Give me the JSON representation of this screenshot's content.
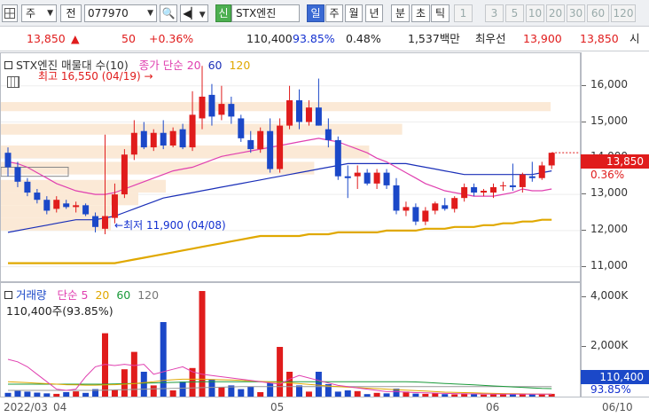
{
  "toolbar": {
    "market_type": "주",
    "tab_jeon": "전",
    "code": "077970",
    "badge_shin": "신",
    "stock_name": "STX엔진",
    "periods": [
      "일",
      "주",
      "월",
      "년"
    ],
    "intraday": [
      "분",
      "초",
      "틱"
    ],
    "intervals": [
      "1",
      "3",
      "5",
      "10",
      "20",
      "30",
      "60",
      "120"
    ],
    "selected_period": "일"
  },
  "quote": {
    "price": "13,850",
    "change": "50",
    "change_pct": "+0.36%",
    "volume": "110,400",
    "vol_ratio": "93.85%",
    "turnover_rate": "0.48%",
    "amount": "1,537백만",
    "best_label": "최우선",
    "ask": "13,900",
    "bid": "13,850",
    "trailing": "시"
  },
  "price_pane": {
    "title": "STX엔진 매물대 수(10)",
    "ma_label": "종가 단순",
    "ma_periods": [
      "20",
      "60",
      "120"
    ],
    "high_note": "최고 16,550 (04/19)",
    "low_note": "최저 11,900 (04/08)",
    "y_ticks": [
      "16,000",
      "15,000",
      "14,000",
      "13,000",
      "12,000",
      "11,000"
    ],
    "current_price": "13,850",
    "current_pct": "0.36%"
  },
  "volume_pane": {
    "title": "거래량",
    "ma_label": "단순",
    "ma_periods": [
      "5",
      "20",
      "60",
      "120"
    ],
    "info": "110,400주(93.85%)",
    "y_ticks": [
      "4,000K",
      "2,000K"
    ],
    "current_volume": "110,400",
    "current_pct": "93.85%"
  },
  "xaxis": {
    "labels": [
      "2022/03",
      "04",
      "05",
      "06",
      "06/10"
    ]
  },
  "colors": {
    "up": "#e01c1c",
    "down": "#1b48c8",
    "ma20": "#e040b0",
    "ma60": "#1a2fb8",
    "ma120": "#e0a800",
    "volume_ma60": "#1a9a3a"
  },
  "chart_data": {
    "type": "candlestick",
    "ylim": [
      10600,
      16900
    ],
    "candles": [
      {
        "o": 14150,
        "h": 14300,
        "l": 13500,
        "c": 13750
      },
      {
        "o": 13750,
        "h": 13900,
        "l": 13200,
        "c": 13350
      },
      {
        "o": 13350,
        "h": 13450,
        "l": 12950,
        "c": 13050
      },
      {
        "o": 13050,
        "h": 13150,
        "l": 12750,
        "c": 12850
      },
      {
        "o": 12850,
        "h": 12950,
        "l": 12450,
        "c": 12550
      },
      {
        "o": 12600,
        "h": 12950,
        "l": 12500,
        "c": 12850
      },
      {
        "o": 12750,
        "h": 12850,
        "l": 12600,
        "c": 12650
      },
      {
        "o": 12650,
        "h": 12800,
        "l": 12500,
        "c": 12700
      },
      {
        "o": 12700,
        "h": 12750,
        "l": 12400,
        "c": 12450
      },
      {
        "o": 12400,
        "h": 12500,
        "l": 11950,
        "c": 12100
      },
      {
        "o": 12050,
        "h": 14650,
        "l": 11900,
        "c": 12400
      },
      {
        "o": 12350,
        "h": 13300,
        "l": 12200,
        "c": 13000
      },
      {
        "o": 13000,
        "h": 14250,
        "l": 12900,
        "c": 14100
      },
      {
        "o": 14100,
        "h": 15050,
        "l": 13950,
        "c": 14700
      },
      {
        "o": 14750,
        "h": 15000,
        "l": 14250,
        "c": 14300
      },
      {
        "o": 14300,
        "h": 14800,
        "l": 14200,
        "c": 14700
      },
      {
        "o": 14700,
        "h": 15050,
        "l": 14250,
        "c": 14350
      },
      {
        "o": 14350,
        "h": 14850,
        "l": 14300,
        "c": 14750
      },
      {
        "o": 14800,
        "h": 14950,
        "l": 14250,
        "c": 14300
      },
      {
        "o": 14300,
        "h": 15850,
        "l": 14200,
        "c": 15200
      },
      {
        "o": 15100,
        "h": 16550,
        "l": 14800,
        "c": 15700
      },
      {
        "o": 15750,
        "h": 16050,
        "l": 14900,
        "c": 15150
      },
      {
        "o": 15200,
        "h": 16000,
        "l": 15050,
        "c": 15500
      },
      {
        "o": 15500,
        "h": 15700,
        "l": 14950,
        "c": 15150
      },
      {
        "o": 15100,
        "h": 15200,
        "l": 14450,
        "c": 14550
      },
      {
        "o": 14500,
        "h": 14750,
        "l": 14150,
        "c": 14250
      },
      {
        "o": 14250,
        "h": 14850,
        "l": 14150,
        "c": 14750
      },
      {
        "o": 14750,
        "h": 15100,
        "l": 13600,
        "c": 13700
      },
      {
        "o": 13700,
        "h": 15100,
        "l": 13600,
        "c": 14900
      },
      {
        "o": 14900,
        "h": 16000,
        "l": 14800,
        "c": 15600
      },
      {
        "o": 15600,
        "h": 15900,
        "l": 14800,
        "c": 15000
      },
      {
        "o": 15000,
        "h": 15600,
        "l": 14900,
        "c": 15400
      },
      {
        "o": 15400,
        "h": 16200,
        "l": 14900,
        "c": 14900
      },
      {
        "o": 14800,
        "h": 15100,
        "l": 14300,
        "c": 14500
      },
      {
        "o": 14500,
        "h": 14600,
        "l": 13400,
        "c": 13500
      },
      {
        "o": 13500,
        "h": 13800,
        "l": 12900,
        "c": 13450
      },
      {
        "o": 13500,
        "h": 13800,
        "l": 13150,
        "c": 13600
      },
      {
        "o": 13600,
        "h": 13700,
        "l": 13250,
        "c": 13300
      },
      {
        "o": 13300,
        "h": 13700,
        "l": 13150,
        "c": 13600
      },
      {
        "o": 13600,
        "h": 13700,
        "l": 13150,
        "c": 13250
      },
      {
        "o": 13250,
        "h": 13450,
        "l": 12450,
        "c": 12550
      },
      {
        "o": 12550,
        "h": 12800,
        "l": 12400,
        "c": 12650
      },
      {
        "o": 12650,
        "h": 12750,
        "l": 12150,
        "c": 12250
      },
      {
        "o": 12250,
        "h": 12650,
        "l": 12150,
        "c": 12550
      },
      {
        "o": 12550,
        "h": 12800,
        "l": 12450,
        "c": 12750
      },
      {
        "o": 12700,
        "h": 12900,
        "l": 12550,
        "c": 12600
      },
      {
        "o": 12600,
        "h": 12950,
        "l": 12500,
        "c": 12900
      },
      {
        "o": 12900,
        "h": 13300,
        "l": 12800,
        "c": 13200
      },
      {
        "o": 13200,
        "h": 13300,
        "l": 12950,
        "c": 13050
      },
      {
        "o": 13050,
        "h": 13150,
        "l": 12950,
        "c": 13100
      },
      {
        "o": 13050,
        "h": 13300,
        "l": 12900,
        "c": 13200
      },
      {
        "o": 13250,
        "h": 13350,
        "l": 13100,
        "c": 13250
      },
      {
        "o": 13250,
        "h": 13850,
        "l": 13100,
        "c": 13200
      },
      {
        "o": 13200,
        "h": 13600,
        "l": 13050,
        "c": 13550
      },
      {
        "o": 13500,
        "h": 13900,
        "l": 13350,
        "c": 13450
      },
      {
        "o": 13450,
        "h": 13900,
        "l": 13400,
        "c": 13800
      },
      {
        "o": 13800,
        "h": 14150,
        "l": 13700,
        "c": 14150
      }
    ],
    "ma20": [
      13900,
      13850,
      13750,
      13600,
      13450,
      13300,
      13200,
      13100,
      13050,
      13000,
      13000,
      13050,
      13150,
      13250,
      13350,
      13450,
      13550,
      13650,
      13700,
      13750,
      13850,
      13950,
      14050,
      14100,
      14150,
      14200,
      14250,
      14300,
      14350,
      14400,
      14450,
      14500,
      14550,
      14500,
      14450,
      14350,
      14250,
      14150,
      14000,
      13900,
      13750,
      13600,
      13450,
      13300,
      13200,
      13100,
      13050,
      13000,
      12950,
      12950,
      12950,
      13000,
      13050,
      13150,
      13100,
      13100,
      13150
    ],
    "ma60": [
      11950,
      12000,
      12050,
      12100,
      12150,
      12200,
      12250,
      12300,
      12300,
      12300,
      12350,
      12400,
      12500,
      12600,
      12700,
      12800,
      12900,
      12950,
      13000,
      13050,
      13100,
      13150,
      13200,
      13250,
      13300,
      13350,
      13400,
      13450,
      13500,
      13550,
      13600,
      13650,
      13700,
      13750,
      13800,
      13850,
      13850,
      13850,
      13850,
      13850,
      13850,
      13850,
      13800,
      13750,
      13700,
      13650,
      13600,
      13550,
      13550,
      13550,
      13550,
      13550,
      13550,
      13550,
      13550,
      13600,
      13650
    ],
    "ma120": [
      11100,
      11100,
      11100,
      11100,
      11100,
      11100,
      11100,
      11100,
      11100,
      11100,
      11100,
      11100,
      11150,
      11200,
      11250,
      11300,
      11350,
      11400,
      11450,
      11500,
      11550,
      11600,
      11650,
      11700,
      11750,
      11800,
      11850,
      11850,
      11850,
      11850,
      11850,
      11900,
      11900,
      11900,
      11950,
      11950,
      11950,
      11950,
      11950,
      12000,
      12000,
      12000,
      12000,
      12050,
      12050,
      12050,
      12100,
      12100,
      12100,
      12150,
      12150,
      12200,
      12200,
      12250,
      12250,
      12300,
      12300
    ],
    "volume_ylim": [
      0,
      4500000
    ],
    "volumes": [
      150000,
      230000,
      200000,
      160000,
      130000,
      110000,
      180000,
      210000,
      150000,
      300000,
      2550000,
      280000,
      1100000,
      1800000,
      1000000,
      450000,
      3000000,
      250000,
      600000,
      1150000,
      4250000,
      700000,
      380000,
      450000,
      300000,
      400000,
      180000,
      550000,
      2000000,
      1000000,
      450000,
      200000,
      1000000,
      500000,
      200000,
      250000,
      220000,
      100000,
      150000,
      130000,
      320000,
      200000,
      120000,
      110000,
      130000,
      100000,
      90000,
      130000,
      100000,
      80000,
      90000,
      100000,
      110000,
      90000,
      100000,
      110000,
      110400
    ],
    "vol_ma5": [
      1500000,
      1400000,
      1200000,
      900000,
      600000,
      300000,
      250000,
      300000,
      800000,
      1200000,
      1300000,
      1250000,
      1300000,
      1250000,
      1300000,
      900000,
      1000000,
      1100000,
      1200000,
      1000000,
      900000,
      850000,
      800000,
      750000,
      700000,
      650000,
      600000,
      550000,
      500000,
      700000,
      850000,
      750000,
      650000,
      550000,
      450000,
      400000,
      350000,
      300000,
      250000,
      200000,
      200000,
      180000,
      160000,
      150000,
      140000,
      130000,
      120000,
      110000,
      110000,
      105000,
      100000,
      100000,
      95000,
      95000,
      100000,
      100000,
      100000
    ],
    "vol_ma20": [
      600000,
      580000,
      560000,
      540000,
      520000,
      500000,
      480000,
      470000,
      460000,
      460000,
      470000,
      480000,
      500000,
      520000,
      560000,
      600000,
      650000,
      680000,
      700000,
      700000,
      700000,
      690000,
      680000,
      670000,
      650000,
      630000,
      610000,
      590000,
      570000,
      550000,
      520000,
      490000,
      460000,
      430000,
      400000,
      380000,
      360000,
      340000,
      320000,
      300000,
      280000,
      260000,
      240000,
      220000,
      200000,
      180000,
      170000,
      160000,
      150000,
      140000,
      130000,
      120000,
      115000,
      110000,
      105000,
      100000,
      100000
    ],
    "vol_ma60": [
      500000,
      500000,
      500000,
      500000,
      500000,
      500000,
      500000,
      500000,
      500000,
      500000,
      500000,
      510000,
      520000,
      530000,
      540000,
      550000,
      560000,
      570000,
      580000,
      590000,
      600000,
      600000,
      600000,
      600000,
      600000,
      600000,
      600000,
      600000,
      600000,
      600000,
      600000,
      600000,
      600000,
      600000,
      600000,
      600000,
      600000,
      600000,
      600000,
      600000,
      600000,
      600000,
      590000,
      570000,
      550000,
      530000,
      510000,
      490000,
      470000,
      450000,
      430000,
      410000,
      390000,
      370000,
      350000,
      330000,
      320000
    ],
    "vol_ma120": [
      250000,
      250000,
      250000,
      250000,
      250000,
      250000,
      250000,
      250000,
      250000,
      250000,
      260000,
      270000,
      280000,
      290000,
      300000,
      310000,
      320000,
      330000,
      340000,
      350000,
      360000,
      370000,
      380000,
      390000,
      400000,
      400000,
      400000,
      400000,
      400000,
      400000,
      400000,
      400000,
      400000,
      400000,
      400000,
      400000,
      400000,
      400000,
      400000,
      400000,
      400000,
      400000,
      400000,
      400000,
      400000,
      400000,
      400000,
      400000,
      400000,
      400000,
      400000,
      400000,
      400000,
      400000,
      400000,
      400000,
      400000
    ],
    "volume_profile": [
      {
        "low": 15300,
        "high": 15550,
        "weight": 1.0
      },
      {
        "low": 14650,
        "high": 14950,
        "weight": 0.73
      },
      {
        "low": 14000,
        "high": 14350,
        "weight": 0.67
      },
      {
        "low": 13550,
        "high": 13900,
        "weight": 0.57
      },
      {
        "low": 13050,
        "high": 13400,
        "weight": 0.3
      },
      {
        "low": 12700,
        "high": 13050,
        "weight": 0.25
      },
      {
        "low": 12350,
        "high": 12700,
        "weight": 0.2
      },
      {
        "low": 12000,
        "high": 12350,
        "weight": 0.2
      }
    ]
  }
}
